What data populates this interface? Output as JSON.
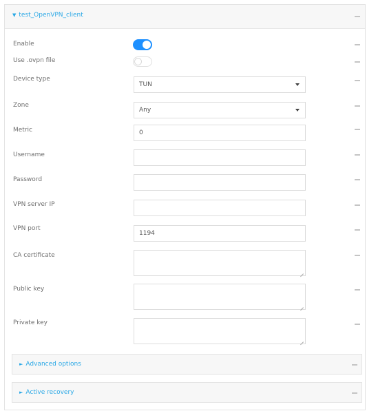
{
  "panel": {
    "title": "test_OpenVPN_client",
    "expand_glyph": "▼"
  },
  "fields": {
    "enable": {
      "label": "Enable",
      "value": true
    },
    "use_ovpn": {
      "label": "Use .ovpn file",
      "value": false
    },
    "device_type": {
      "label": "Device type",
      "value": "TUN"
    },
    "zone": {
      "label": "Zone",
      "value": "Any"
    },
    "metric": {
      "label": "Metric",
      "value": "0"
    },
    "username": {
      "label": "Username",
      "value": ""
    },
    "password": {
      "label": "Password",
      "value": ""
    },
    "vpn_server_ip": {
      "label": "VPN server IP",
      "value": ""
    },
    "vpn_port": {
      "label": "VPN port",
      "value": "1194"
    },
    "ca_certificate": {
      "label": "CA certificate"
    },
    "public_key": {
      "label": "Public key"
    },
    "private_key": {
      "label": "Private key"
    }
  },
  "sections": {
    "advanced": {
      "title": "Advanced options",
      "glyph": "►"
    },
    "recovery": {
      "title": "Active recovery",
      "glyph": "►"
    }
  },
  "colors": {
    "accent": "#2aa8e6",
    "toggle_on": "#1e90ff",
    "border": "#dcdcdc"
  }
}
